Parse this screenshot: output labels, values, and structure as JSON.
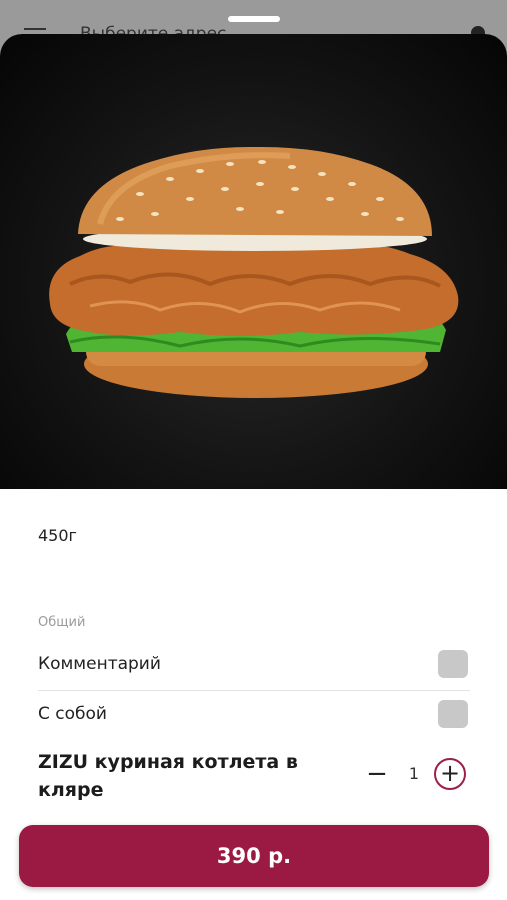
{
  "background_screen": {
    "title": "Выберите адрес",
    "menu_icon": "hamburger-menu-icon"
  },
  "product": {
    "image_alt": "chicken-burger-photo",
    "weight": "450г",
    "name": "ZIZU куриная котлета в кляре",
    "quantity": "1",
    "minus_symbol": "−",
    "plus_symbol": "+"
  },
  "options": {
    "section_label": "Общий",
    "items": [
      {
        "label": "Комментарий",
        "checked": false
      },
      {
        "label": "С собой",
        "checked": false
      }
    ]
  },
  "cta": {
    "price_label": "390 р."
  },
  "colors": {
    "accent": "#9b1a44",
    "checkbox": "#c8c8c8",
    "hero_bg": "#141414"
  }
}
